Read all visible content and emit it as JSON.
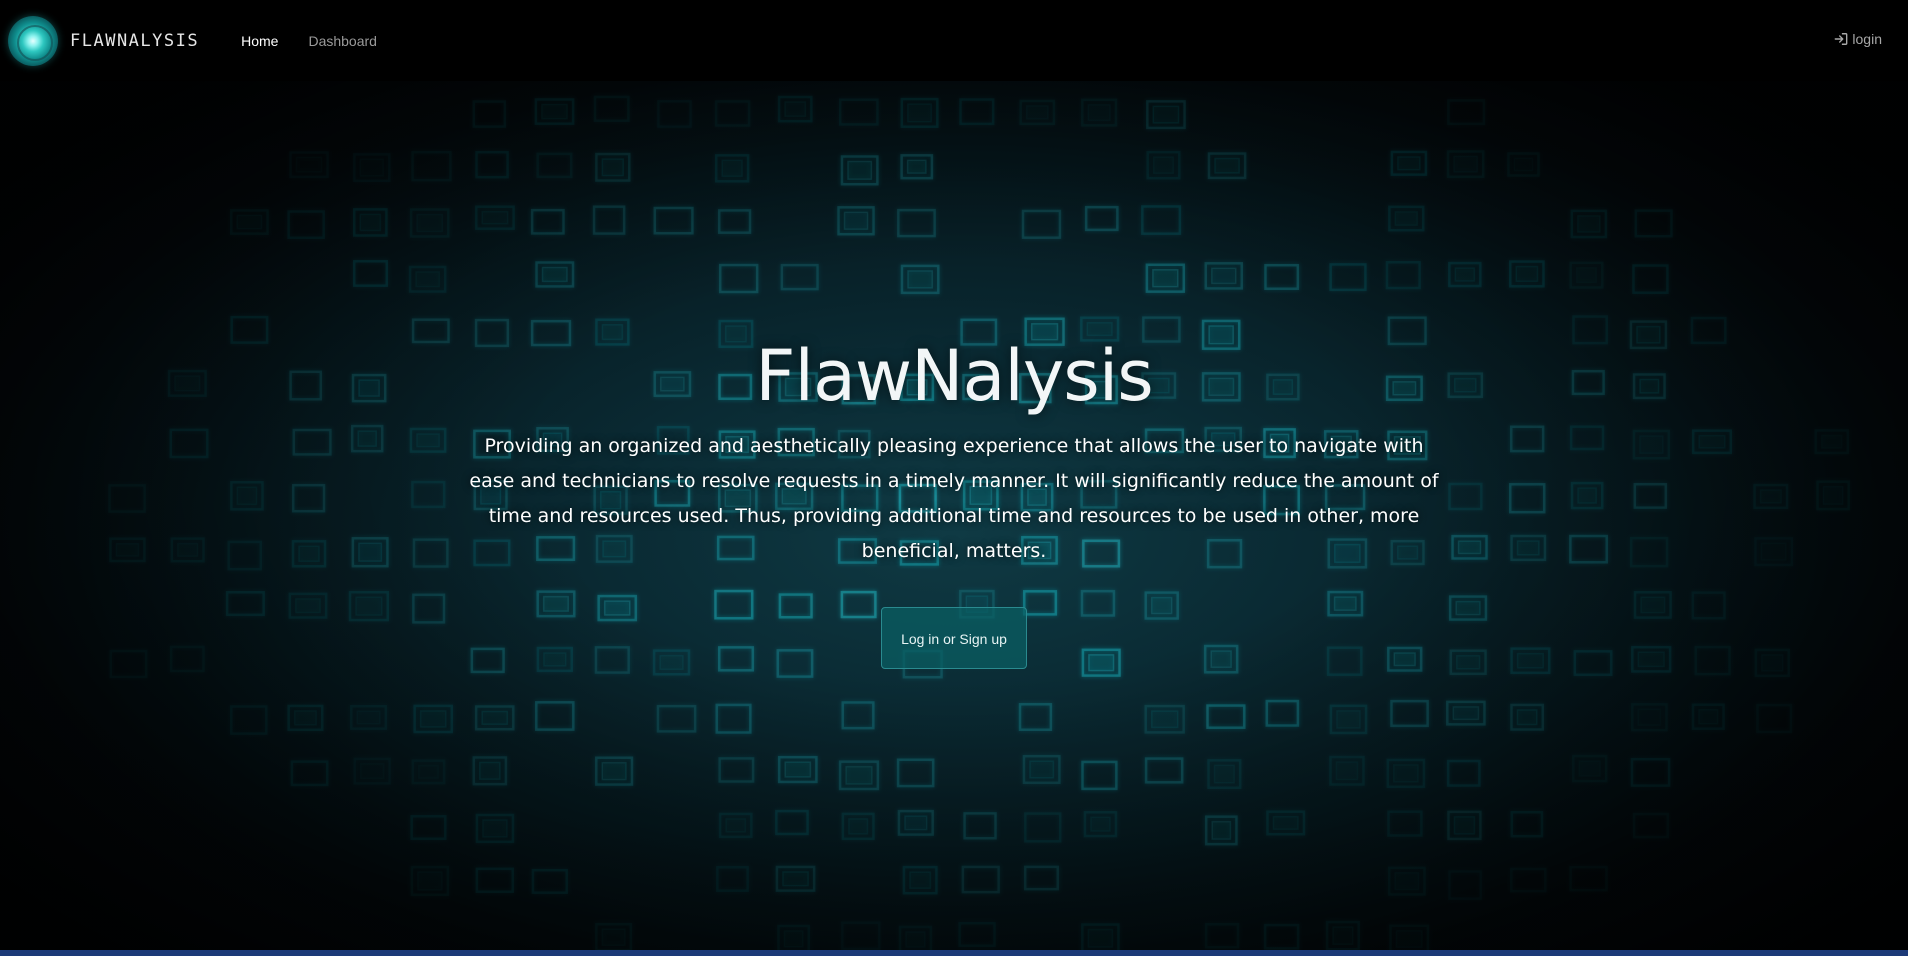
{
  "navbar": {
    "brand_name": "FLAWNALYSIS",
    "links": [
      {
        "label": "Home",
        "active": true
      },
      {
        "label": "Dashboard",
        "active": false
      }
    ],
    "login_label": "login",
    "login_icon": "sign-in-icon"
  },
  "hero": {
    "title": "FlawNalysis",
    "description": "Providing an organized and aesthetically pleasing experience that allows the user to navigate with ease and technicians to resolve requests in a timely manner. It will significantly reduce the amount of time and resources used. Thus, providing additional time and resources to be used in other, more beneficial, matters.",
    "cta_label": "Log in or Sign up"
  },
  "colors": {
    "background": "#000000",
    "accent": "#0a5f64",
    "grid_glow": "#1fb3bf",
    "bottom_border": "#1c3a78"
  }
}
